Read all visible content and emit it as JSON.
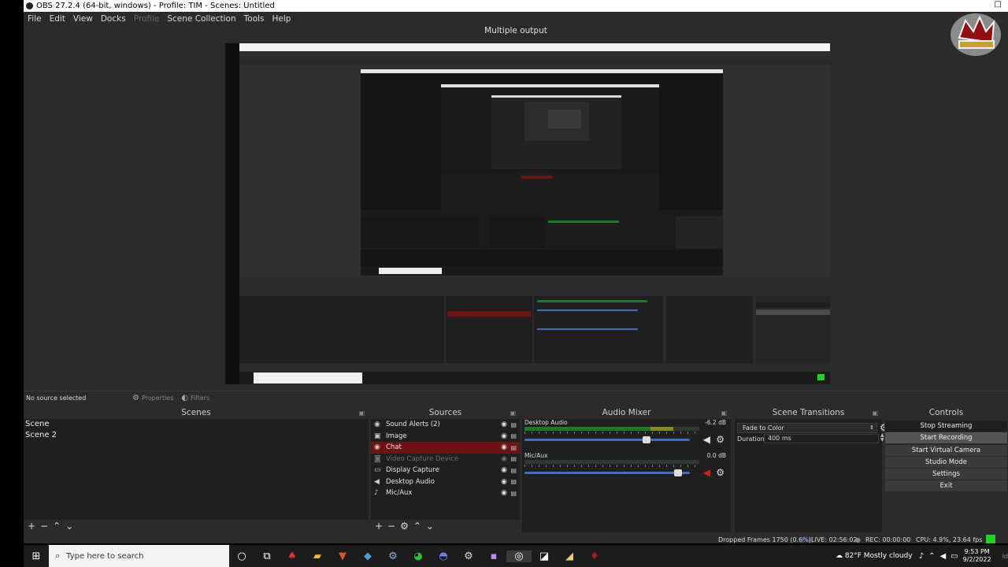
{
  "window": {
    "title": "OBS 27.2.4 (64-bit, windows) - Profile: TIM - Scenes: Untitled",
    "close_glyph": "□"
  },
  "menu": {
    "items": [
      "File",
      "Edit",
      "View",
      "Docks",
      "Profile",
      "Scene Collection",
      "Tools",
      "Help"
    ]
  },
  "multiview_title": "Multiple output",
  "source_toolbar": {
    "no_source": "No source selected",
    "properties": "Properties",
    "filters": "Filters"
  },
  "scenes": {
    "title": "Scenes",
    "items": [
      "Scene",
      "Scene 2"
    ]
  },
  "sources": {
    "title": "Sources",
    "items": [
      {
        "name": "Sound Alerts (2)",
        "icon": "globe-icon",
        "glyph": "◉",
        "selected": false,
        "disabled": false
      },
      {
        "name": "Image",
        "icon": "image-icon",
        "glyph": "▣",
        "selected": false,
        "disabled": false
      },
      {
        "name": "Chat",
        "icon": "globe-icon",
        "glyph": "◉",
        "selected": true,
        "disabled": false
      },
      {
        "name": "Video Capture Device",
        "icon": "camera-icon",
        "glyph": "◙",
        "selected": false,
        "disabled": true
      },
      {
        "name": "Display Capture",
        "icon": "monitor-icon",
        "glyph": "▭",
        "selected": false,
        "disabled": false
      },
      {
        "name": "Desktop Audio",
        "icon": "speaker-icon",
        "glyph": "◀",
        "selected": false,
        "disabled": false
      },
      {
        "name": "Mic/Aux",
        "icon": "microphone-icon",
        "glyph": "♪",
        "selected": false,
        "disabled": false
      }
    ]
  },
  "mixer": {
    "title": "Audio Mixer",
    "channels": [
      {
        "name": "Desktop Audio",
        "db": "-6.2 dB",
        "level": 0.85,
        "fader": 0.75,
        "muted": false
      },
      {
        "name": "Mic/Aux",
        "db": "0.0 dB",
        "level": 0.0,
        "fader": 0.95,
        "muted": true
      }
    ]
  },
  "transitions": {
    "title": "Scene Transitions",
    "selected": "Fade to Color",
    "duration_label": "Duration",
    "duration_value": "400 ms"
  },
  "controls": {
    "title": "Controls",
    "buttons": [
      "Stop Streaming",
      "Start Recording",
      "Start Virtual Camera",
      "Studio Mode",
      "Settings",
      "Exit"
    ]
  },
  "status": {
    "dropped": "Dropped Frames 1750 (0.6%)",
    "live": "LIVE: 02:56:02",
    "rec": "REC: 00:00:00",
    "cpu": "CPU: 4.9%, 23.64 fps",
    "indicator_color": "#1ed41e",
    "edge_text": "Id"
  },
  "taskbar": {
    "search_placeholder": "Type here to search",
    "apps": [
      "cortana-icon",
      "task-view-icon",
      "app-icon",
      "folder-icon",
      "brave-icon",
      "app-icon",
      "steam-icon",
      "wechat-icon",
      "discord-icon",
      "settings-icon",
      "premiere-icon",
      "obs-icon",
      "app-icon",
      "app-icon",
      "app-icon"
    ],
    "weather": "82°F Mostly cloudy",
    "time": "9:53 PM",
    "date": "9/2/2022"
  },
  "colors": {
    "selected_source": "#6e1313",
    "accent_fader": "#3d6fc0",
    "live_green": "#1ed41e"
  }
}
